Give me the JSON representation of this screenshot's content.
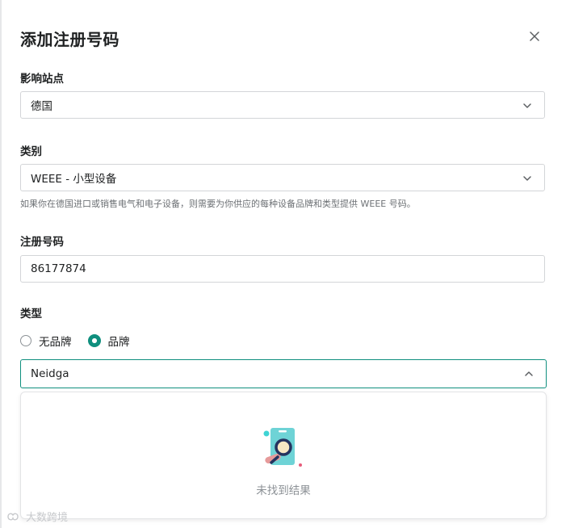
{
  "modal": {
    "title": "添加注册号码",
    "close_icon": "close-icon"
  },
  "site": {
    "label": "影响站点",
    "value": "德国"
  },
  "category": {
    "label": "类别",
    "value": "WEEE - 小型设备",
    "help": "如果你在德国进口或销售电气和电子设备，则需要为你供应的每种设备品牌和类型提供 WEEE 号码。"
  },
  "registration": {
    "label": "注册号码",
    "value": "86177874"
  },
  "type": {
    "label": "类型",
    "options": [
      {
        "label": "无品牌",
        "checked": false
      },
      {
        "label": "品牌",
        "checked": true
      }
    ]
  },
  "brand": {
    "value": "Neidga"
  },
  "dropdown": {
    "empty_text": "未找到结果",
    "illustration": "search-empty-illustration"
  },
  "watermark": {
    "text": "大数跨境"
  },
  "colors": {
    "accent": "#0f8f7e",
    "border": "#d3d5d8",
    "muted": "#6d7175"
  }
}
